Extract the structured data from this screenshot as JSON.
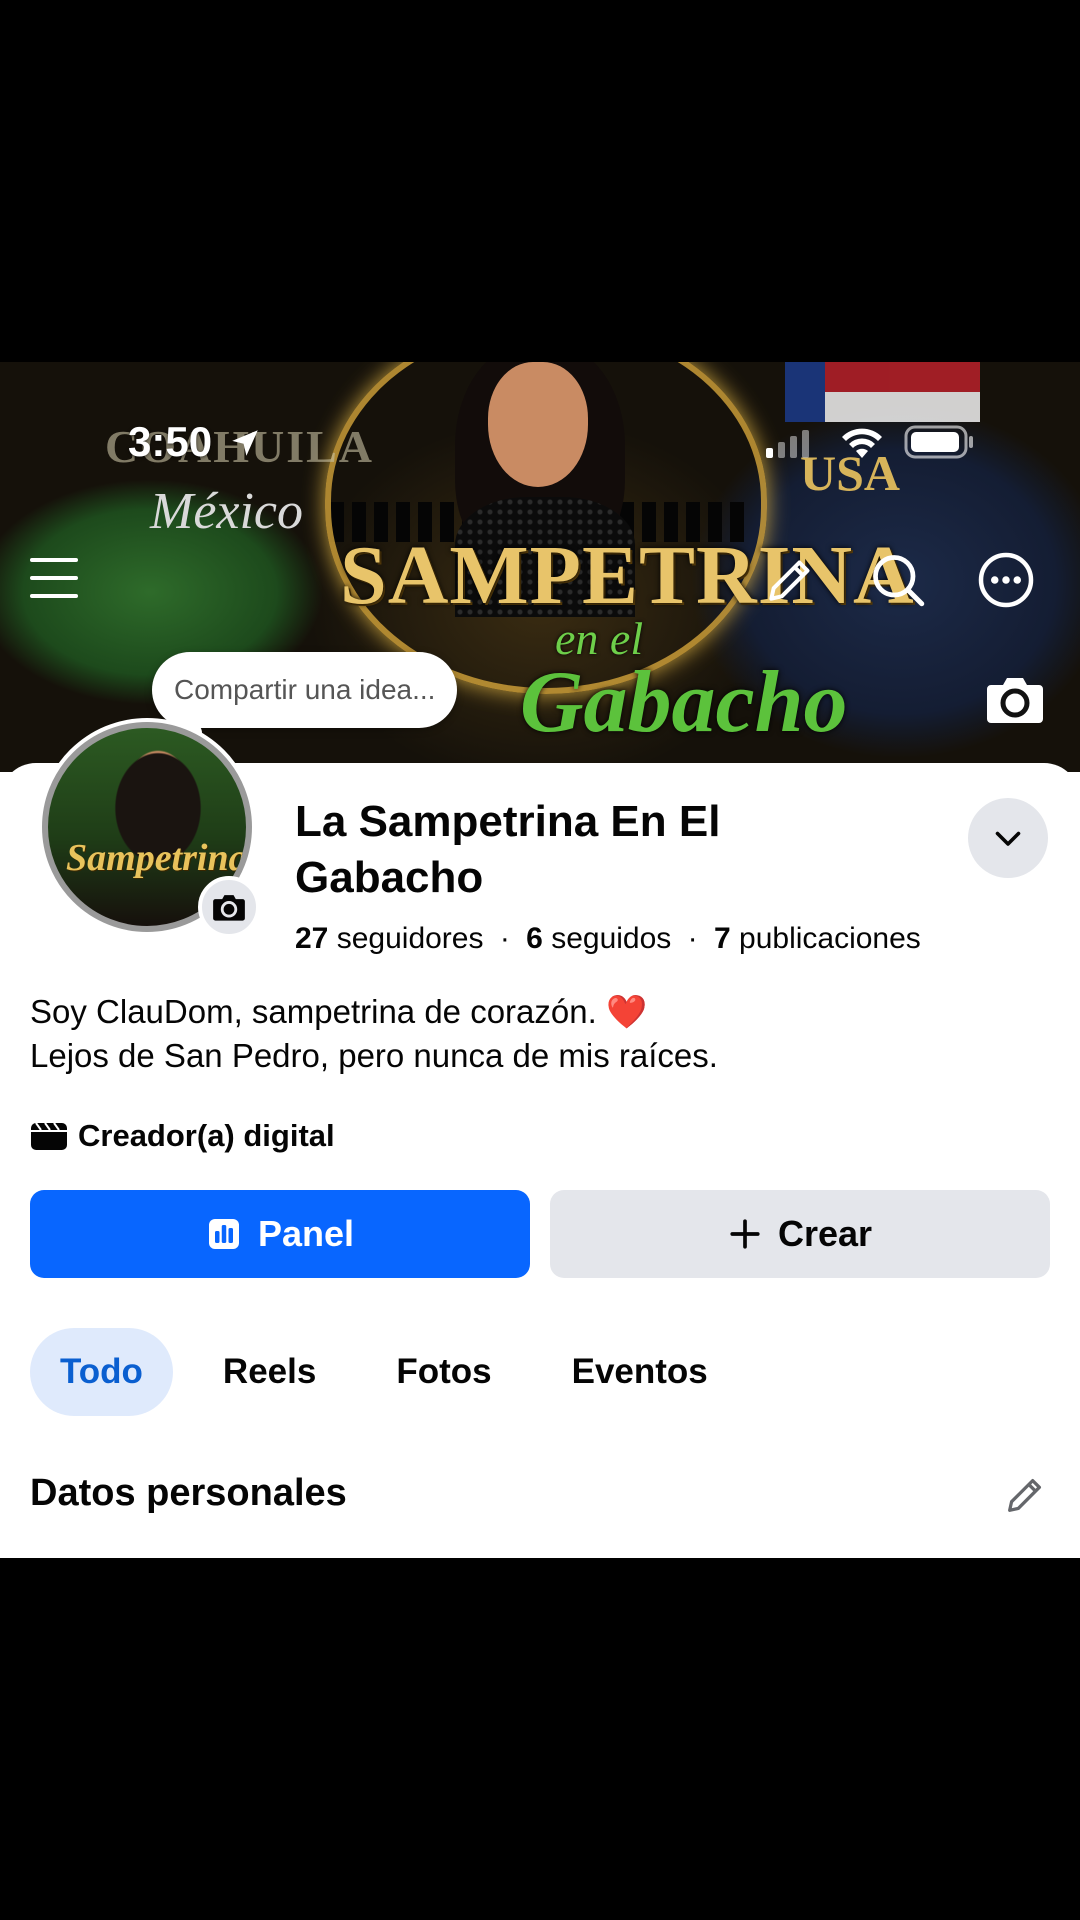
{
  "status_bar": {
    "time": "3:50"
  },
  "cover": {
    "text_coahuila": "COAHUILA",
    "text_mexico": "México",
    "text_usa": "USA",
    "title": "SAMPETRINA",
    "subtitle_small": "en el",
    "subtitle_large": "Gabacho"
  },
  "share_prompt": {
    "placeholder": "Compartir una idea..."
  },
  "avatar": {
    "text": "Sampetrina"
  },
  "profile": {
    "name": "La Sampetrina En El Gabacho",
    "followers_count": "27",
    "followers_label": "seguidores",
    "following_count": "6",
    "following_label": "seguidos",
    "posts_count": "7",
    "posts_label": "publicaciones",
    "separator": "·"
  },
  "bio": {
    "line1": "Soy ClauDom, sampetrina de corazón.",
    "line1_emoji": "❤️",
    "line2": "Lejos de San Pedro, pero nunca de mis raíces."
  },
  "category": {
    "label": "Creador(a) digital",
    "icon": "clapperboard-icon"
  },
  "actions": {
    "panel_label": "Panel",
    "crear_label": "Crear",
    "accent": "#0866ff"
  },
  "tabs": [
    {
      "label": "Todo",
      "active": true
    },
    {
      "label": "Reels",
      "active": false
    },
    {
      "label": "Fotos",
      "active": false
    },
    {
      "label": "Eventos",
      "active": false
    }
  ],
  "section": {
    "title": "Datos personales"
  }
}
